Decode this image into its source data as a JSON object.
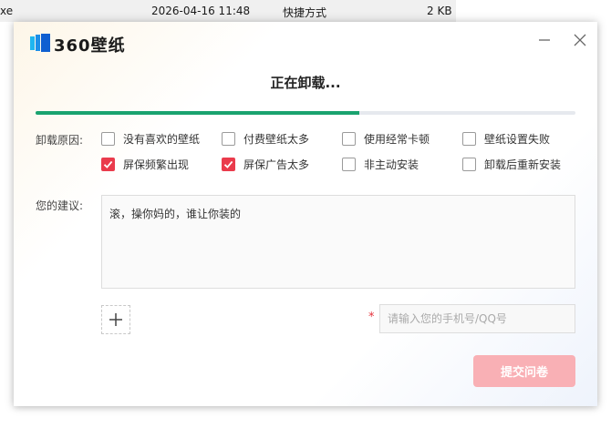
{
  "background_window": {
    "name_fragment": "xe",
    "date_modified": "2026-04-16 11:48",
    "type": "快捷方式",
    "size": "2 KB"
  },
  "header": {
    "logo_text": "360壁纸",
    "logo_icon": "360-wallpaper-logo-icon",
    "minimize_icon": "minimize-icon",
    "close_icon": "close-icon"
  },
  "title": "正在卸载...",
  "progress": {
    "fraction": 0.6,
    "color": "#1aa36f",
    "track_color": "#e6e9ee"
  },
  "reasons": {
    "label": "卸载原因:",
    "items": [
      {
        "label": "没有喜欢的壁纸",
        "checked": false
      },
      {
        "label": "付费壁纸太多",
        "checked": false
      },
      {
        "label": "使用经常卡顿",
        "checked": false
      },
      {
        "label": "壁纸设置失败",
        "checked": false
      },
      {
        "label": "屏保频繁出现",
        "checked": true
      },
      {
        "label": "屏保广告太多",
        "checked": true
      },
      {
        "label": "非主动安装",
        "checked": false
      },
      {
        "label": "卸载后重新安装",
        "checked": false
      }
    ]
  },
  "suggestion": {
    "label": "您的建议:",
    "value": "滚，操你妈的，谁让你装的"
  },
  "add_attachment_icon": "plus-icon",
  "contact": {
    "required_mark": "*",
    "placeholder": "请输入您的手机号/QQ号",
    "value": ""
  },
  "submit_label": "提交问卷",
  "colors": {
    "accent_red": "#ea3b4c",
    "submit_disabled": "#f9b0b5",
    "progress_green": "#1aa36f"
  }
}
